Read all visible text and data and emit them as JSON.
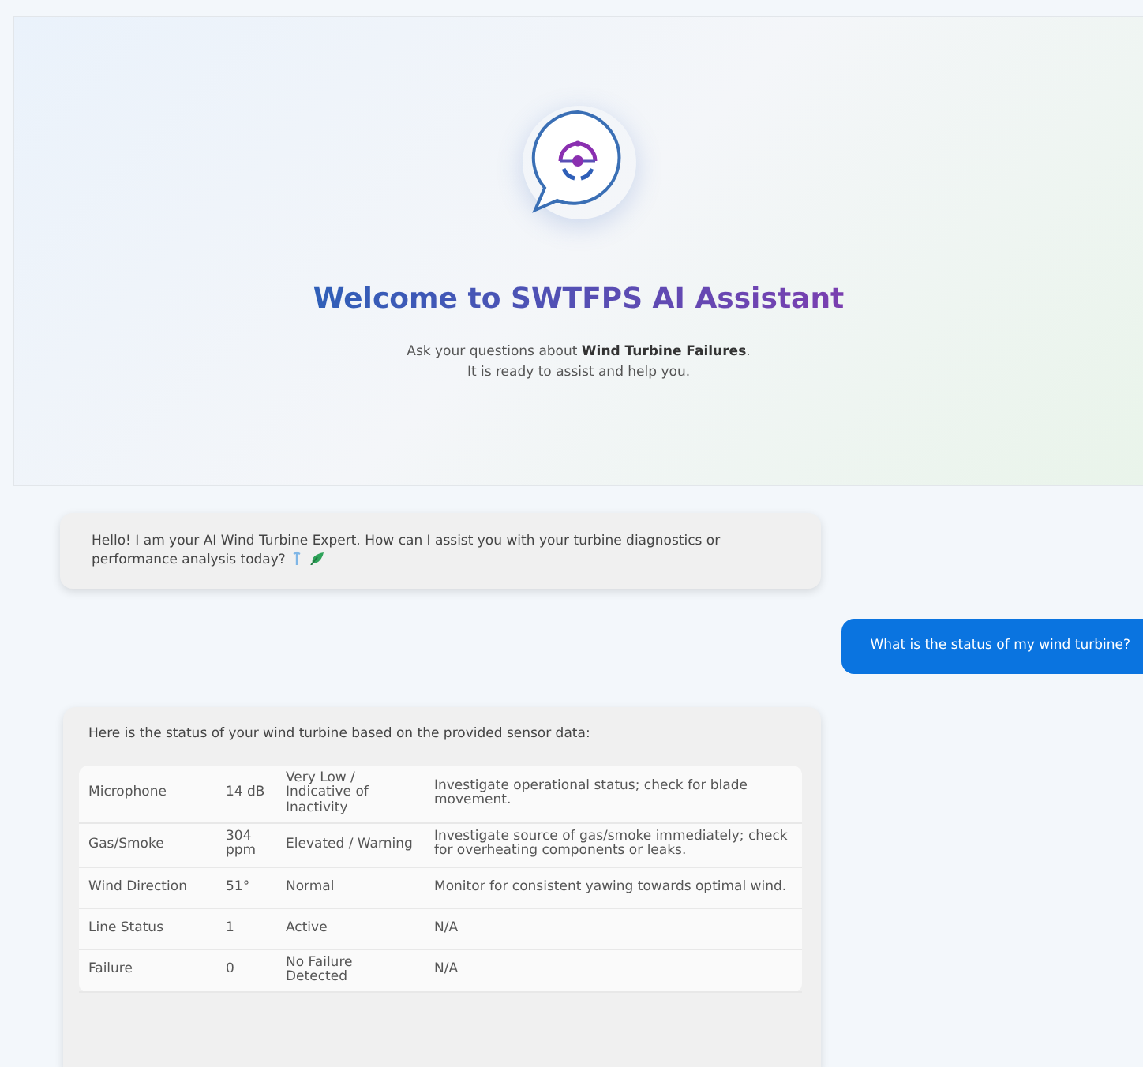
{
  "header": {
    "title": "Welcome to SWTFPS AI Assistant",
    "subtitle_lines": [
      "Ask your questions about **Wind Turbine Failures**.",
      "It is ready to assist and help you."
    ]
  },
  "messages": [
    {
      "kind": "bot",
      "text": "Hello! I am your AI Wind Turbine Expert. How can I assist you with your turbine diagnostics or performance analysis today?",
      "emoji_icons": true
    },
    {
      "kind": "user",
      "text": "What is the status of my wind turbine?"
    },
    {
      "kind": "bot_table",
      "text": "Here is the status of your wind turbine based on the provided sensor data:",
      "table": {
        "rows": [
          {
            "column_1": "Microphone",
            "column_2": "14 dB",
            "column_3": "Very Low / Indicative of Inactivity",
            "column_4": "Investigate operational status; check for blade movement."
          },
          {
            "column_1": "Gas/Smoke",
            "column_2": "304 ppm",
            "column_3": "Elevated / Warning",
            "column_4": "Investigate source of gas/smoke immediately; check for overheating components or leaks."
          },
          {
            "column_1": "Wind Direction",
            "column_2": "51°",
            "column_3": "Normal",
            "column_4": "Monitor for consistent yawing towards optimal wind."
          },
          {
            "column_1": "Line Status",
            "column_2": "1",
            "column_3": "Active",
            "column_4": "N/A"
          },
          {
            "column_1": "Failure",
            "column_2": "0",
            "column_3": "No Failure Detected",
            "column_4": "N/A"
          }
        ]
      }
    }
  ]
}
